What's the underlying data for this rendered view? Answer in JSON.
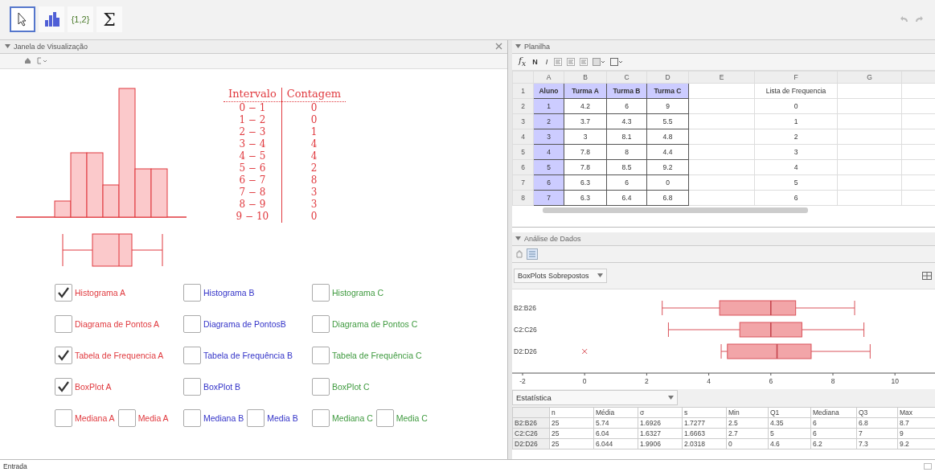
{
  "toolbar": {
    "tools": [
      {
        "kind": "pointer",
        "selected": true
      },
      {
        "kind": "histogram",
        "selected": false
      },
      {
        "kind": "list",
        "label": "{1,2}",
        "selected": false
      },
      {
        "kind": "sum",
        "label": "Σ",
        "selected": false
      }
    ]
  },
  "graphics_view": {
    "title": "Janela de Visualização",
    "frequency_table": {
      "columns": [
        "Intervalo",
        "Contagem"
      ],
      "rows": [
        {
          "interval": "0 − 1",
          "count": "0"
        },
        {
          "interval": "1 − 2",
          "count": "0"
        },
        {
          "interval": "2 − 3",
          "count": "1"
        },
        {
          "interval": "3 − 4",
          "count": "4"
        },
        {
          "interval": "4 − 5",
          "count": "4"
        },
        {
          "interval": "5 − 6",
          "count": "2"
        },
        {
          "interval": "6 − 7",
          "count": "8"
        },
        {
          "interval": "7 − 8",
          "count": "3"
        },
        {
          "interval": "8 − 9",
          "count": "3"
        },
        {
          "interval": "9 − 10",
          "count": "0"
        }
      ]
    },
    "checkbox_rows": [
      [
        [
          {
            "label": "Histograma A",
            "checked": true,
            "color": "#e0393e"
          }
        ],
        [
          {
            "label": "Histograma B",
            "checked": false,
            "color": "#3333c8"
          }
        ],
        [
          {
            "label": "Histograma C",
            "checked": false,
            "color": "#3f9a3f"
          }
        ]
      ],
      [
        [
          {
            "label": "Diagrama de Pontos A",
            "checked": false,
            "color": "#e0393e"
          }
        ],
        [
          {
            "label": "Diagrama de PontosB",
            "checked": false,
            "color": "#3333c8"
          }
        ],
        [
          {
            "label": "Diagrama de Pontos C",
            "checked": false,
            "color": "#3f9a3f"
          }
        ]
      ],
      [
        [
          {
            "label": "Tabela de Frequencia A",
            "checked": true,
            "color": "#e0393e"
          }
        ],
        [
          {
            "label": "Tabela de Frequência B",
            "checked": false,
            "color": "#3333c8"
          }
        ],
        [
          {
            "label": "Tabela de Frequência C",
            "checked": false,
            "color": "#3f9a3f"
          }
        ]
      ],
      [
        [
          {
            "label": "BoxPlot A",
            "checked": true,
            "color": "#e0393e"
          }
        ],
        [
          {
            "label": "BoxPlot B",
            "checked": false,
            "color": "#3333c8"
          }
        ],
        [
          {
            "label": "BoxPlot C",
            "checked": false,
            "color": "#3f9a3f"
          }
        ]
      ],
      [
        [
          {
            "label": "Mediana A",
            "checked": false,
            "color": "#e0393e"
          },
          {
            "label": "Media A",
            "checked": false,
            "color": "#e0393e"
          }
        ],
        [
          {
            "label": "Mediana B",
            "checked": false,
            "color": "#3333c8"
          },
          {
            "label": "Media B",
            "checked": false,
            "color": "#3333c8"
          }
        ],
        [
          {
            "label": "Mediana C",
            "checked": false,
            "color": "#3f9a3f"
          },
          {
            "label": "Media C",
            "checked": false,
            "color": "#3f9a3f"
          }
        ]
      ]
    ]
  },
  "spreadsheet": {
    "title": "Planilha",
    "function_label": "f$_{x}$",
    "format_buttons": [
      "N",
      "I"
    ],
    "columns": [
      "A",
      "B",
      "C",
      "D",
      "E",
      "F",
      "G"
    ],
    "rows": [
      {
        "number": "1",
        "cells": {
          "A": {
            "text": "Aluno",
            "highlighted": true
          },
          "B": {
            "text": "Turma A",
            "highlighted": true
          },
          "C": {
            "text": "Turma B",
            "highlighted": true
          },
          "D": {
            "text": "Turma C",
            "highlighted": true
          },
          "F": {
            "text": "Lista de Frequencia",
            "highlighted": false
          }
        }
      },
      {
        "number": "2",
        "cells": {
          "A": {
            "text": "1",
            "highlighted": true
          },
          "B": {
            "text": "4.2",
            "highlighted": false
          },
          "C": {
            "text": "6",
            "highlighted": false
          },
          "D": {
            "text": "9",
            "highlighted": false
          },
          "F": {
            "text": "0",
            "highlighted": false
          }
        }
      },
      {
        "number": "3",
        "cells": {
          "A": {
            "text": "2",
            "highlighted": true
          },
          "B": {
            "text": "3.7",
            "highlighted": false
          },
          "C": {
            "text": "4.3",
            "highlighted": false
          },
          "D": {
            "text": "5.5",
            "highlighted": false
          },
          "F": {
            "text": "1",
            "highlighted": false
          }
        }
      },
      {
        "number": "4",
        "cells": {
          "A": {
            "text": "3",
            "highlighted": true
          },
          "B": {
            "text": "3",
            "highlighted": false
          },
          "C": {
            "text": "8.1",
            "highlighted": false
          },
          "D": {
            "text": "4.8",
            "highlighted": false
          },
          "F": {
            "text": "2",
            "highlighted": false
          }
        }
      },
      {
        "number": "5",
        "cells": {
          "A": {
            "text": "4",
            "highlighted": true
          },
          "B": {
            "text": "7.8",
            "highlighted": false
          },
          "C": {
            "text": "8",
            "highlighted": false
          },
          "D": {
            "text": "4.4",
            "highlighted": false
          },
          "F": {
            "text": "3",
            "highlighted": false
          }
        }
      },
      {
        "number": "6",
        "cells": {
          "A": {
            "text": "5",
            "highlighted": true
          },
          "B": {
            "text": "7.8",
            "highlighted": false
          },
          "C": {
            "text": "8.5",
            "highlighted": false
          },
          "D": {
            "text": "9.2",
            "highlighted": false
          },
          "F": {
            "text": "4",
            "highlighted": false
          }
        }
      },
      {
        "number": "7",
        "cells": {
          "A": {
            "text": "6",
            "highlighted": true
          },
          "B": {
            "text": "6.3",
            "highlighted": false
          },
          "C": {
            "text": "6",
            "highlighted": false
          },
          "D": {
            "text": "0",
            "highlighted": false
          },
          "F": {
            "text": "5",
            "highlighted": false
          }
        }
      },
      {
        "number": "8",
        "cells": {
          "A": {
            "text": "7",
            "highlighted": true
          },
          "B": {
            "text": "6.3",
            "highlighted": false
          },
          "C": {
            "text": "6.4",
            "highlighted": false
          },
          "D": {
            "text": "6.8",
            "highlighted": false
          },
          "F": {
            "text": "6",
            "highlighted": false
          }
        }
      }
    ]
  },
  "data_analysis": {
    "title": "Análise de Dados",
    "plot_type": "BoxPlots Sobrepostos",
    "boxplot_labels": [
      "B2:B26",
      "C2:C26",
      "D2:D26"
    ],
    "axis_ticks": [
      "-2",
      "0",
      "2",
      "4",
      "6",
      "8",
      "10"
    ],
    "statistics": {
      "title": "Estatística",
      "columns": [
        "n",
        "Média",
        "σ",
        "s",
        "Min",
        "Q1",
        "Mediana",
        "Q3",
        "Max"
      ],
      "rows": [
        {
          "label": "B2:B26",
          "values": [
            "25",
            "5.74",
            "1.6926",
            "1.7277",
            "2.5",
            "4.35",
            "6",
            "6.8",
            "8.7"
          ]
        },
        {
          "label": "C2:C26",
          "values": [
            "25",
            "6.04",
            "1.6327",
            "1.6663",
            "2.7",
            "5",
            "6",
            "7",
            "9"
          ]
        },
        {
          "label": "D2:D26",
          "values": [
            "25",
            "6.044",
            "1.9906",
            "2.0318",
            "0",
            "4.6",
            "6.2",
            "7.3",
            "9.2"
          ]
        }
      ]
    }
  },
  "input_bar": {
    "label": "Entrada"
  }
}
